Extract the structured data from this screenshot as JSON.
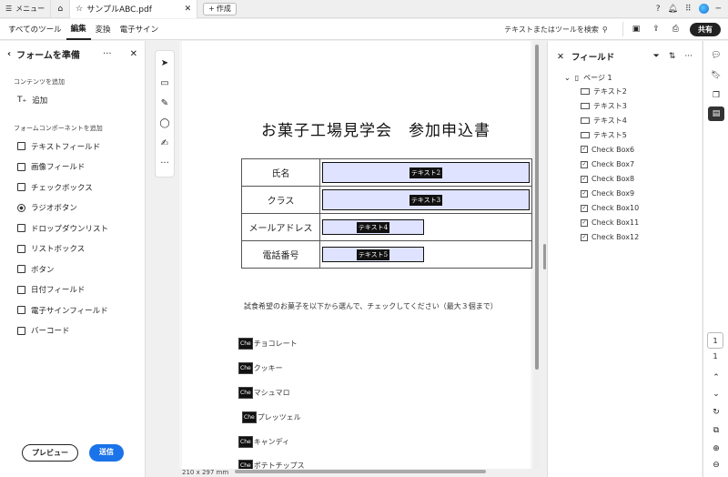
{
  "titlebar": {
    "menu_label": "メニュー",
    "tab_name": "サンプルABC.pdf",
    "create_label": "作成"
  },
  "toolbar": {
    "tabs": [
      {
        "label": "すべてのツール"
      },
      {
        "label": "編集"
      },
      {
        "label": "変換"
      },
      {
        "label": "電子サイン"
      }
    ],
    "search_placeholder": "テキストまたはツールを検索",
    "share_label": "共有"
  },
  "left_panel": {
    "title": "フォームを準備",
    "section_content": "コンテンツを追加",
    "add_label": "追加",
    "section_components": "フォームコンポーネントを追加",
    "components": [
      {
        "label": "テキストフィールド",
        "icon": "text-field-icon"
      },
      {
        "label": "画像フィールド",
        "icon": "image-field-icon"
      },
      {
        "label": "チェックボックス",
        "icon": "checkbox-icon"
      },
      {
        "label": "ラジオボタン",
        "icon": "radio-icon"
      },
      {
        "label": "ドロップダウンリスト",
        "icon": "dropdown-icon"
      },
      {
        "label": "リストボックス",
        "icon": "listbox-icon"
      },
      {
        "label": "ボタン",
        "icon": "button-icon"
      },
      {
        "label": "日付フィールド",
        "icon": "date-field-icon"
      },
      {
        "label": "電子サインフィールド",
        "icon": "signature-field-icon"
      },
      {
        "label": "バーコード",
        "icon": "barcode-icon"
      }
    ],
    "preview_label": "プレビュー",
    "send_label": "送信"
  },
  "document": {
    "title": "お菓子工場見学会　参加申込書",
    "rows": [
      {
        "label": "氏名",
        "field": "テキスト2"
      },
      {
        "label": "クラス",
        "field": "テキスト3"
      },
      {
        "label": "メールアドレス",
        "field": "テキスト4"
      },
      {
        "label": "電話番号",
        "field": "テキスト5"
      }
    ],
    "instruction": "試食希望のお菓子を以下から選んで、チェックしてください（最大３個まで）",
    "checkbox_marker": "Che",
    "options": [
      "チョコレート",
      "クッキー",
      "マシュマロ",
      "プレッツェル",
      "キャンディ",
      "ポテトチップス"
    ],
    "page_size": "210 x 297 mm"
  },
  "fields_panel": {
    "title": "フィールド",
    "page_label": "ページ 1",
    "text_fields": [
      "テキスト2",
      "テキスト3",
      "テキスト4",
      "テキスト5"
    ],
    "check_fields": [
      "Check Box6",
      "Check Box7",
      "Check Box8",
      "Check Box9",
      "Check Box10",
      "Check Box11",
      "Check Box12"
    ]
  },
  "right_rail": {
    "current_page": "1",
    "total_pages": "1"
  }
}
